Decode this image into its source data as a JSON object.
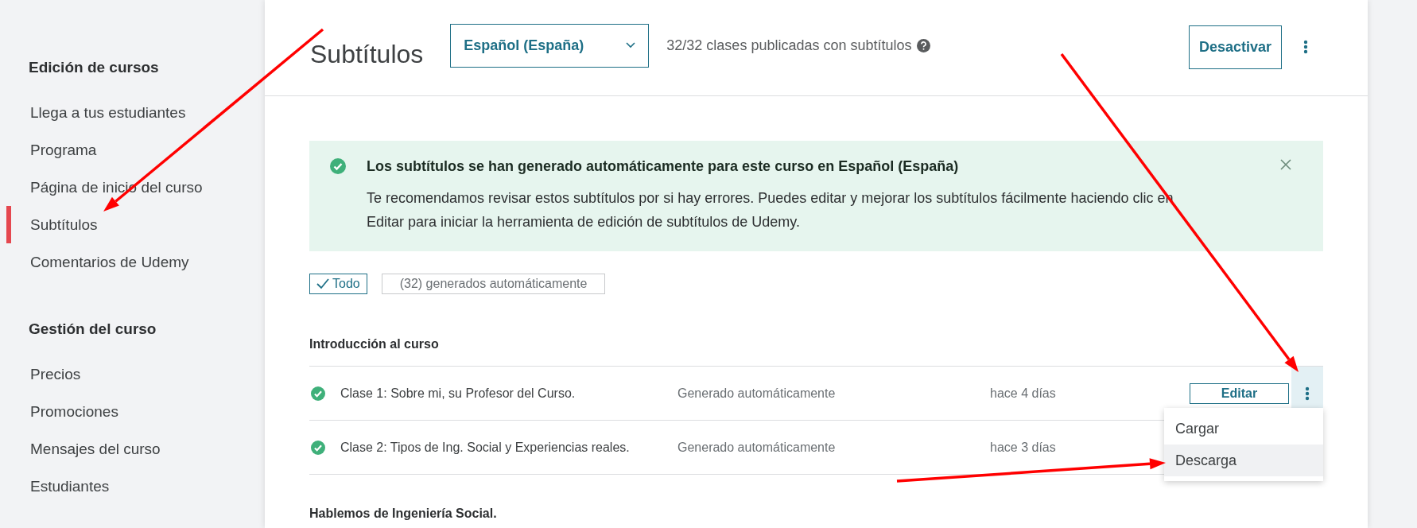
{
  "sidebar": {
    "sections": [
      {
        "title": "Edición de cursos",
        "items": [
          {
            "label": "Llega a tus estudiantes",
            "selected": false
          },
          {
            "label": "Programa",
            "selected": false
          },
          {
            "label": "Página de inicio del curso",
            "selected": false
          },
          {
            "label": "Subtítulos",
            "selected": true
          },
          {
            "label": "Comentarios de Udemy",
            "selected": false
          }
        ]
      },
      {
        "title": "Gestión del curso",
        "items": [
          {
            "label": "Precios",
            "selected": false
          },
          {
            "label": "Promociones",
            "selected": false
          },
          {
            "label": "Mensajes del curso",
            "selected": false
          },
          {
            "label": "Estudiantes",
            "selected": false
          }
        ]
      }
    ]
  },
  "header": {
    "title": "Subtítulos",
    "language": "Español (España)",
    "summary": "32/32 clases publicadas con subtítulos",
    "button": "Desactivar"
  },
  "banner": {
    "title": "Los subtítulos se han generado automáticamente para este curso en Español (España)",
    "text": "Te recomendamos revisar estos subtítulos por si hay errores. Puedes editar y mejorar los subtítulos fácilmente haciendo clic en Editar para iniciar la herramienta de edición de subtítulos de Udemy."
  },
  "filters": [
    {
      "label": "Todo",
      "selected": true
    },
    {
      "label": "(32) generados automáticamente",
      "selected": false
    }
  ],
  "sections": [
    {
      "title": "Introducción al curso",
      "rows": [
        {
          "title": "Clase 1: Sobre mi, su Profesor del Curso.",
          "status": "Generado automáticamente",
          "date": "hace 4 días",
          "button": "Editar",
          "menu": [
            {
              "label": "Cargar",
              "selected": false
            },
            {
              "label": "Descarga",
              "selected": true
            }
          ]
        },
        {
          "title": "Clase 2: Tipos de Ing. Social y Experiencias reales.",
          "status": "Generado automáticamente",
          "date": "hace 3 días"
        }
      ]
    },
    {
      "title": "Hablemos de Ingeniería Social."
    }
  ]
}
